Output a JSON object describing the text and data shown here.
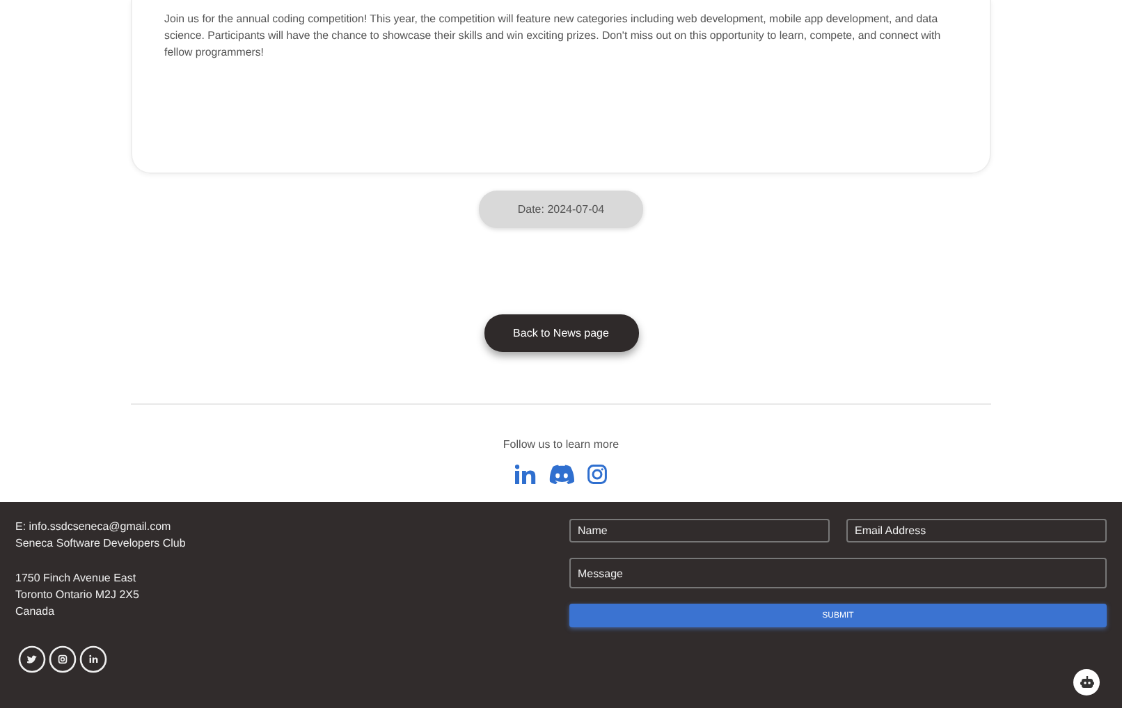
{
  "article": {
    "body": "Join us for the annual coding competition! This year, the competition will feature new categories including web development, mobile app development, and data science. Participants will have the chance to showcase their skills and win exciting prizes. Don't miss out on this opportunity to learn, compete, and connect with fellow programmers!",
    "date": "Date: 2024-07-04"
  },
  "back_button": "Back to News page",
  "follow": {
    "text": "Follow us to learn more",
    "icons": [
      {
        "kind": "linkedin"
      },
      {
        "kind": "discord"
      },
      {
        "kind": "instagram"
      }
    ]
  },
  "footer": {
    "contact": [
      "E: info.ssdcseneca@gmail.com",
      "Seneca Software Developers Club"
    ],
    "address": [
      "1750 Finch Avenue East",
      "Toronto Ontario M2J 2X5",
      "Canada"
    ],
    "social": [
      {
        "kind": "twitter"
      },
      {
        "kind": "instagram"
      },
      {
        "kind": "linkedin"
      }
    ],
    "form": {
      "name_placeholder": "Name",
      "email_placeholder": "Email Address",
      "message_placeholder": "Message",
      "submit": "SUBMIT"
    }
  }
}
